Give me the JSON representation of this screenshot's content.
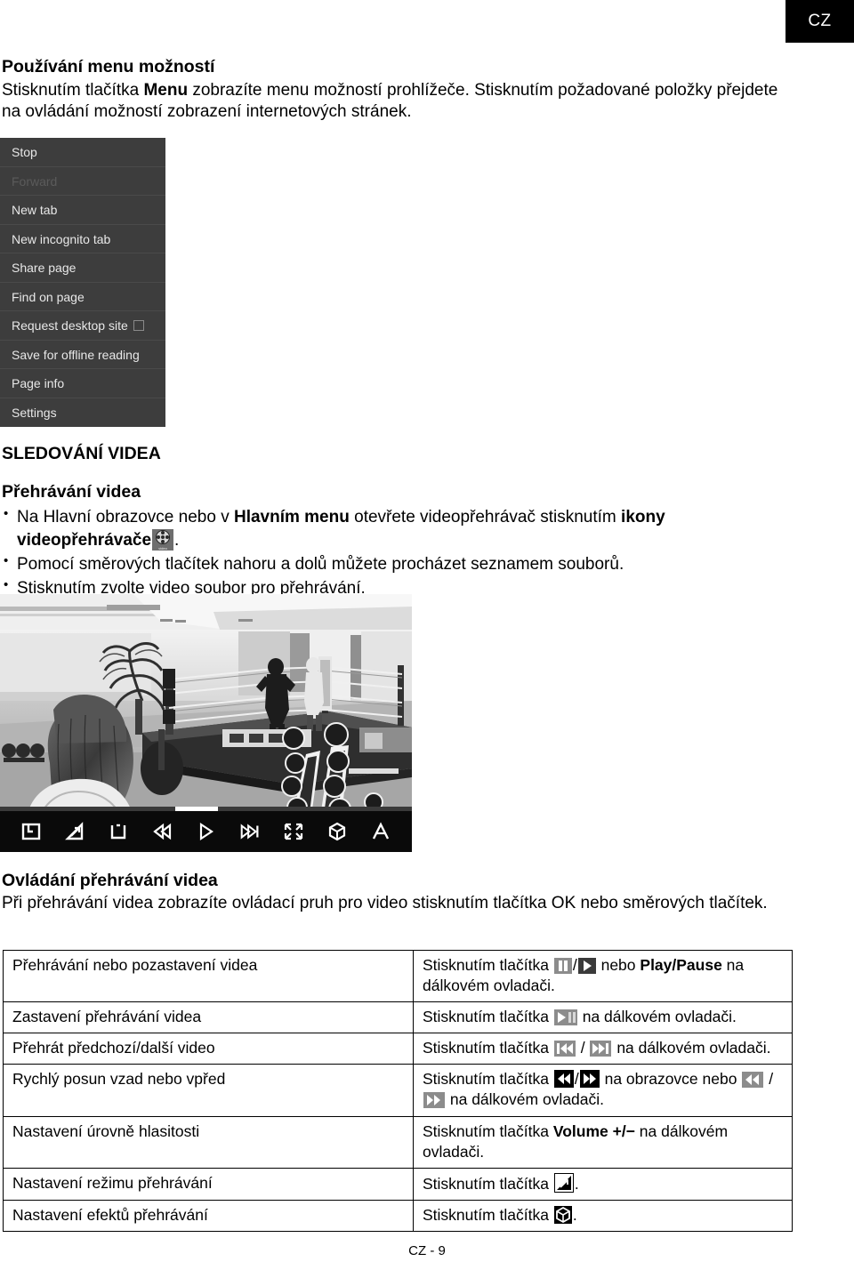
{
  "badge": {
    "label": "CZ"
  },
  "intro": {
    "heading": "Používání menu možností",
    "body_part1": "Stisknutím tlačítka ",
    "body_bold": "Menu",
    "body_part2": " zobrazíte menu možností prohlížeče. Stisknutím požadované položky přejdete na ovládání možností zobrazení internetových stránek."
  },
  "browser_menu": {
    "items": [
      {
        "label": "Stop",
        "disabled": false,
        "checkbox": false
      },
      {
        "label": "Forward",
        "disabled": true,
        "checkbox": false
      },
      {
        "label": "New tab",
        "disabled": false,
        "checkbox": false
      },
      {
        "label": "New incognito tab",
        "disabled": false,
        "checkbox": false
      },
      {
        "label": "Share page",
        "disabled": false,
        "checkbox": false
      },
      {
        "label": "Find on page",
        "disabled": false,
        "checkbox": false
      },
      {
        "label": "Request desktop site",
        "disabled": false,
        "checkbox": true
      },
      {
        "label": "Save for offline reading",
        "disabled": false,
        "checkbox": false
      },
      {
        "label": "Page info",
        "disabled": false,
        "checkbox": false
      },
      {
        "label": "Settings",
        "disabled": false,
        "checkbox": false
      }
    ]
  },
  "watching": {
    "section_heading": "SLEDOVÁNÍ VIDEA",
    "sub_heading": "Přehrávání videa",
    "bullet1_a": "Na Hlavní obrazovce nebo v ",
    "bullet1_b": "Hlavním menu",
    "bullet1_c": " otevřete videopřehrávač stisknutím ",
    "bullet1_d": "ikony videopřehrávače",
    "bullet1_e": ".",
    "bullet2": "Pomocí směrových tlačítek nahoru a dolů můžete procházet seznamem souborů.",
    "bullet3": "Stisknutím zvolte video soubor pro přehrávání.",
    "reel_icon_label": "video"
  },
  "player_controls": {
    "icons": [
      "bookmark-icon",
      "repeat-mode-icon",
      "stop-icon",
      "previous-track-icon",
      "play-icon",
      "next-track-icon",
      "fullscreen-icon",
      "effects-cube-icon",
      "subtitle-a-icon"
    ]
  },
  "playback": {
    "heading": "Ovládání přehrávání videa",
    "body": "Při přehrávání videa zobrazíte ovládací pruh pro video stisknutím tlačítka OK nebo směrových tlačítek."
  },
  "table": {
    "rows": [
      {
        "action": "Přehrávání nebo pozastavení videa",
        "desc_a": "Stisknutím tlačítka ",
        "icon1": "pause-icon",
        "sep": "/",
        "icon2": "play-icon",
        "desc_b": " nebo ",
        "bold": "Play/Pause",
        "desc_c": " na dálkovém ovladači."
      },
      {
        "action": "Zastavení přehrávání videa",
        "desc_a": "Stisknutím tlačítka ",
        "icon1": "play-pause-icon",
        "desc_c": " na dálkovém ovladači."
      },
      {
        "action": "Přehrát předchozí/další video",
        "desc_a": "Stisknutím tlačítka ",
        "icon1": "previous-track-icon",
        "sep": " / ",
        "icon2": "next-track-icon",
        "desc_c": " na dálkovém ovladači."
      },
      {
        "action": "Rychlý posun vzad nebo vpřed",
        "desc_a": "Stisknutím tlačítka ",
        "icon1": "rewind-black-icon",
        "sep": "/",
        "icon2": "forward-black-icon",
        "desc_b": " na obrazovce nebo ",
        "icon3": "rewind-gray-icon",
        "sep2": " / ",
        "icon4": "forward-gray-icon",
        "desc_c": " na dálkovém ovladači."
      },
      {
        "action": "Nastavení úrovně hlasitosti",
        "desc_a": "Stisknutím tlačítka ",
        "bold": "Volume +/−",
        "desc_c": " na dálkovém ovladači."
      },
      {
        "action": "Nastavení režimu přehrávání",
        "desc_a": "Stisknutím tlačítka ",
        "icon1": "repeat-mode-icon",
        "desc_c": "."
      },
      {
        "action": "Nastavení efektů přehrávání",
        "desc_a": "Stisknutím tlačítka ",
        "icon1": "effects-cube-icon",
        "desc_c": "."
      }
    ]
  },
  "footer": {
    "label": "CZ - 9"
  },
  "colors": {
    "menu_bg": "#3d3d3d",
    "menu_text": "#e8e8e8",
    "menu_disabled": "#5b5b5b",
    "badge_bg": "#000000",
    "icon_gray": "#8c8c8c",
    "icon_dark": "#3a3a3a"
  }
}
